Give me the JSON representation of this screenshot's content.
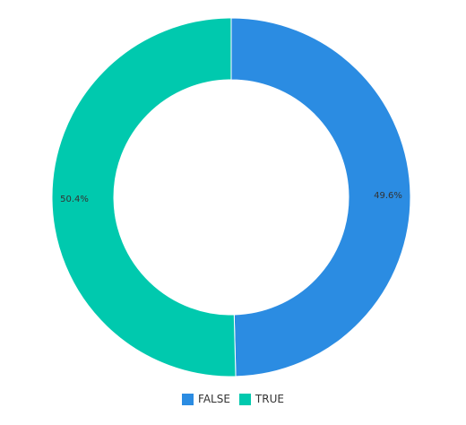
{
  "chart_data": {
    "type": "pie",
    "donut": true,
    "categories": [
      "FALSE",
      "TRUE"
    ],
    "values": [
      49.6,
      50.4
    ],
    "labels": [
      "49.6%",
      "50.4%"
    ],
    "colors": [
      "#2b8ce2",
      "#00c9ae"
    ],
    "legend_position": "bottom"
  },
  "legend": {
    "items": [
      {
        "label": "FALSE",
        "color": "#2b8ce2"
      },
      {
        "label": "TRUE",
        "color": "#00c9ae"
      }
    ]
  }
}
